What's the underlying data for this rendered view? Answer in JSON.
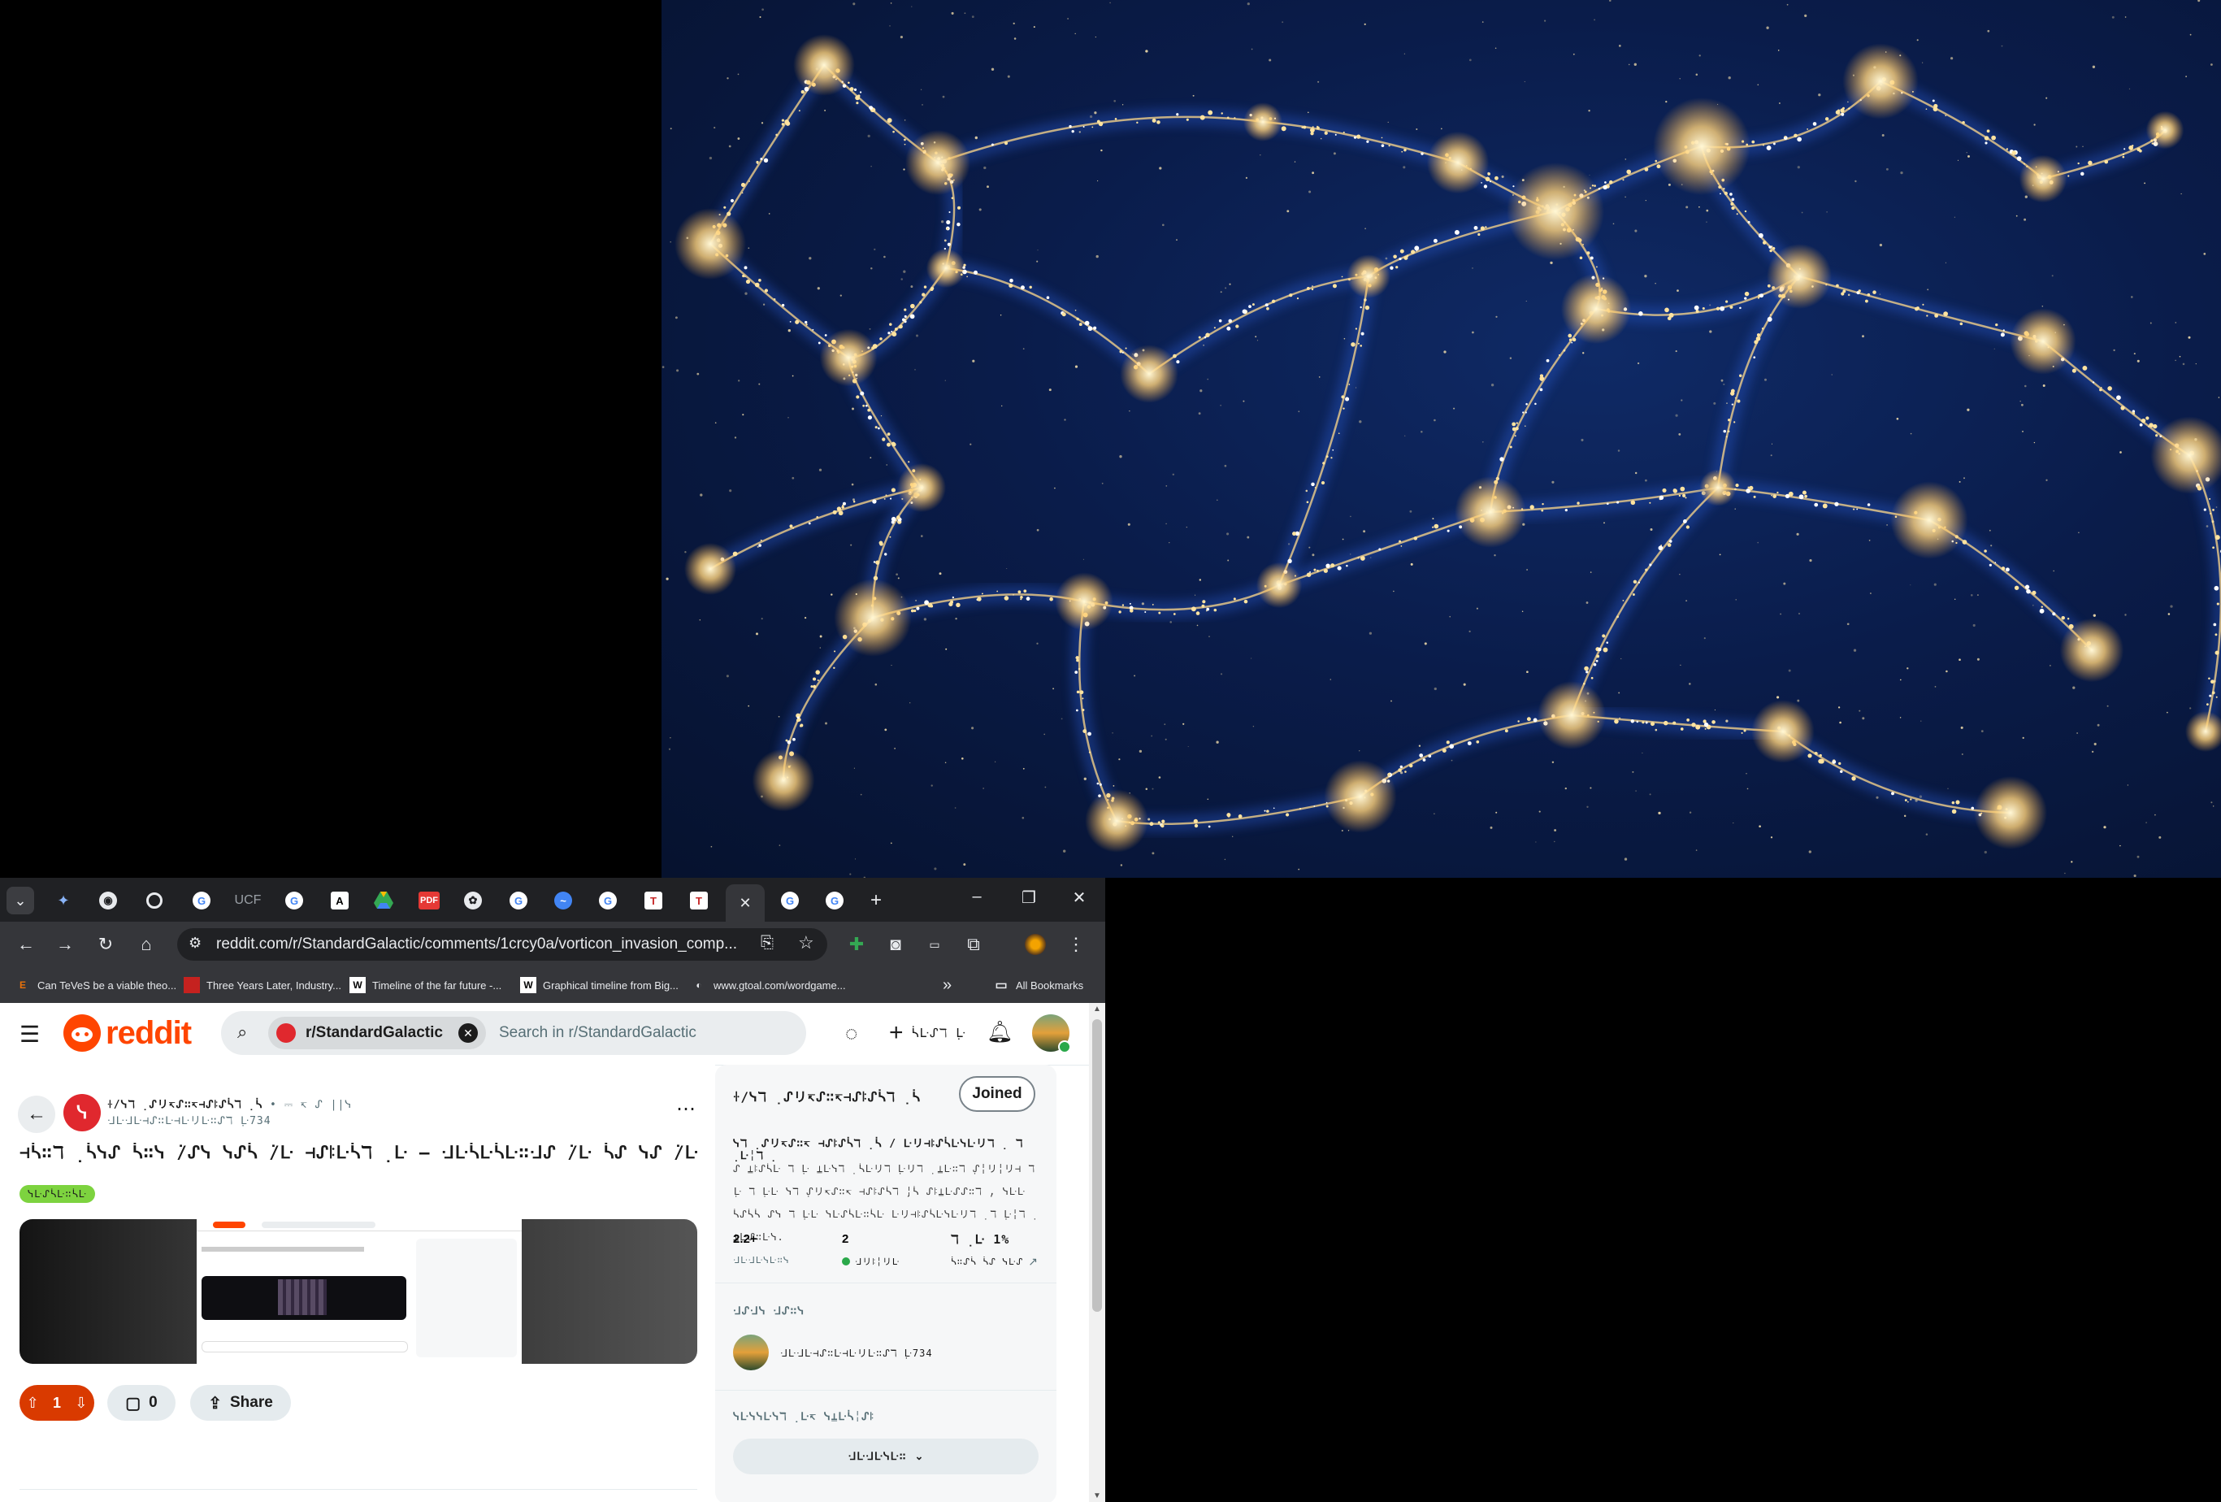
{
  "browser": {
    "url": "reddit.com/r/StandardGalactic/comments/1crcy0a/vorticon_invasion_comp...",
    "tab_icons": [
      "tab-search-icon",
      "gemini-icon",
      "github-icon",
      "chrome-icon",
      "google-icon",
      "ucf-icon",
      "google-icon",
      "a-icon",
      "drive-icon",
      "pdf-icon",
      "openai-icon",
      "google-icon",
      "wave-icon",
      "google-icon",
      "t-icon",
      "t-icon",
      "close-icon",
      "google-icon",
      "google-icon",
      "new-tab-icon"
    ],
    "tab_labels": {
      "ucf": "UCF",
      "pdf": "PDF",
      "a": "A",
      "t": "T"
    },
    "bookmarks": [
      {
        "label": "Can TeVeS be a viable theo...",
        "icon": "E",
        "color": "#e8710a"
      },
      {
        "label": "Three Years Later, Industry...",
        "icon": "▮",
        "color": "#c5221f"
      },
      {
        "label": "Timeline of the far future -...",
        "icon": "W",
        "color": "#ffffff"
      },
      {
        "label": "Graphical timeline from Big...",
        "icon": "W",
        "color": "#ffffff"
      },
      {
        "label": "www.gtoal.com/wordgame...",
        "icon": "◐",
        "color": "#e8eaed"
      }
    ],
    "overflow_label": "»",
    "all_bookmarks": "All Bookmarks"
  },
  "reddit": {
    "logo": "reddit",
    "search_chip": "r/StandardGalactic",
    "search_placeholder": "Search in r/StandardGalactic",
    "create_label": "ᓵᒷᔑℸ ̣ᒷ",
    "post": {
      "subreddit": "ꖌ/ᓭℸ ̣ᔑリ↸ᔑ∷↸⊣ᔑꖎᔑᓵℸ ̣ᓵ",
      "time": "• ⎓ ↸ ᔑ ||ᓭ",
      "author": "ᒲᒷᒲᒷ⊣ᔑ∷ᒷ⊣ᒷリᒷ∷ᔑℸ ̣ᒷ734",
      "title": "⊣ᓵ∷ℸ ̣ᓵᓭᔑ ᓵ∷ᓭ ̇/ᔑᓭ ᓭᔑᓵ ̇/ᒷ ⊣ᔑꖎᒷᓵℸ ̣ᒷ – ᒲᒷᓵᒷᓵᒷ∷ᒲᔑ ̇/ᒷ ᓵᔑ ᓭᔑ ̇/ᒷ ᓭᔑᓵ ̇/ᒷ ᓭᔑᓵ ̇/ᒷ",
      "flair": "ᓭᒷᔑᓵᒷ∷ᓵᒷ",
      "votes": "1",
      "comments": "0",
      "share": "Share"
    },
    "sidebar": {
      "name": "ꖌ/ᓭℸ ̣ᔑリ↸ᔑ∷↸⊣ᔑꖎᔑᓵℸ ̣ᓵ",
      "joined": "Joined",
      "subtitle": "ᓭℸ ̣ᔑリ↸ᔑ∷↸ ⊣ᔑꖎᔑᓵℸ ̣ᓵ / ᒷリ⊣ꖎᔑᓵᒷᓭᒷリℸ ̣ ℸ ̣ᒷ╎ℸ ̣",
      "description": "ᔑ ⍊ꖎᔑᓵᒷ ℸ ̣ᒷ ⍊ᒷᓭℸ ̣ ᓵᒷリℸ ̣ᒷリℸ ̣ ⍊ᒷ∷ℸ ̣ᔑ╎リ╎リ⊣ ℸ ̣ᒷ ℸ ̣ᒷᒷ ᓭℸ ̣ᔑリ↸ᔑ∷↸ ⊣ᔑꖎᔑᓵℸ ̣╎ᓵ ᔑꖎ⍊ᒷᔑᔑ∷ℸ ̣, ᓭᒷᒷ ᓵᔑᓵᓵ ᔑᓭ ℸ ̣ᒷᒷ ᓭᒷᔑᓵᒷ∷ᓵᒷ ᒷリ⊣ꖎᔑᓵᒷᓭᒷリℸ ̣ ℸ ̣ᒷ╎ℸ ̣ ⍊ᒷᔑ∷ᒷᓭ.",
      "stats": [
        {
          "value": "2.2+",
          "label": "ᒲᒷᒲᒷᓭᒷ∷ᓭ"
        },
        {
          "value": "2",
          "label": "ᒲリꖎ╎リᒷ"
        },
        {
          "value": "ℸ ̣ᒷ 1%",
          "label": "ᓵ∷ᔑᓵ ᓵᔑ ᓭᒷᔑ"
        }
      ],
      "mods_heading": "ᒲᔑᒲᓭ ᒲᔑ∷ᓭ",
      "mod_user": "ᒲᒷᒲᒷ⊣ᔑ∷ᒷ⊣ᒷリᒷ∷ᔑℸ ̣ᒷ734",
      "related_heading": "ᓭᒷᓭᓭᒷᓭℸ ̣ᒷ↸ ᓭ⍊ᒷᓵ╎ᔑꖎ",
      "more_button": "ᒲᒷᒲᒷᓭᒷ∷"
    }
  },
  "colors": {
    "reddit_orange": "#ff4500",
    "flair_green": "#7dd33f",
    "online_green": "#2aa84a",
    "browser_dark": "#202124",
    "browser_toolbar": "#35363a"
  }
}
